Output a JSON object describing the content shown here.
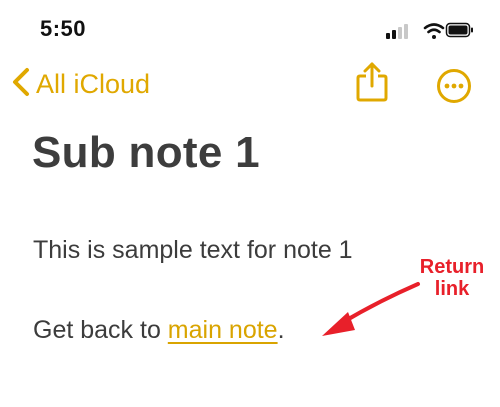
{
  "status_bar": {
    "time": "5:50"
  },
  "nav": {
    "back_label": "All iCloud",
    "back_icon": "chevron-left-icon",
    "share_icon": "share-icon",
    "more_icon": "ellipsis-circle-icon"
  },
  "note": {
    "title": "Sub note 1",
    "body_line": "This is sample text for note 1",
    "link_prefix": "Get back to ",
    "link_text": "main note",
    "link_suffix": "."
  },
  "annotation": {
    "line1": "Return",
    "line2": "link"
  },
  "colors": {
    "accent": "#e0a800",
    "text": "#3c3c3c",
    "annotation": "#e8202a"
  }
}
